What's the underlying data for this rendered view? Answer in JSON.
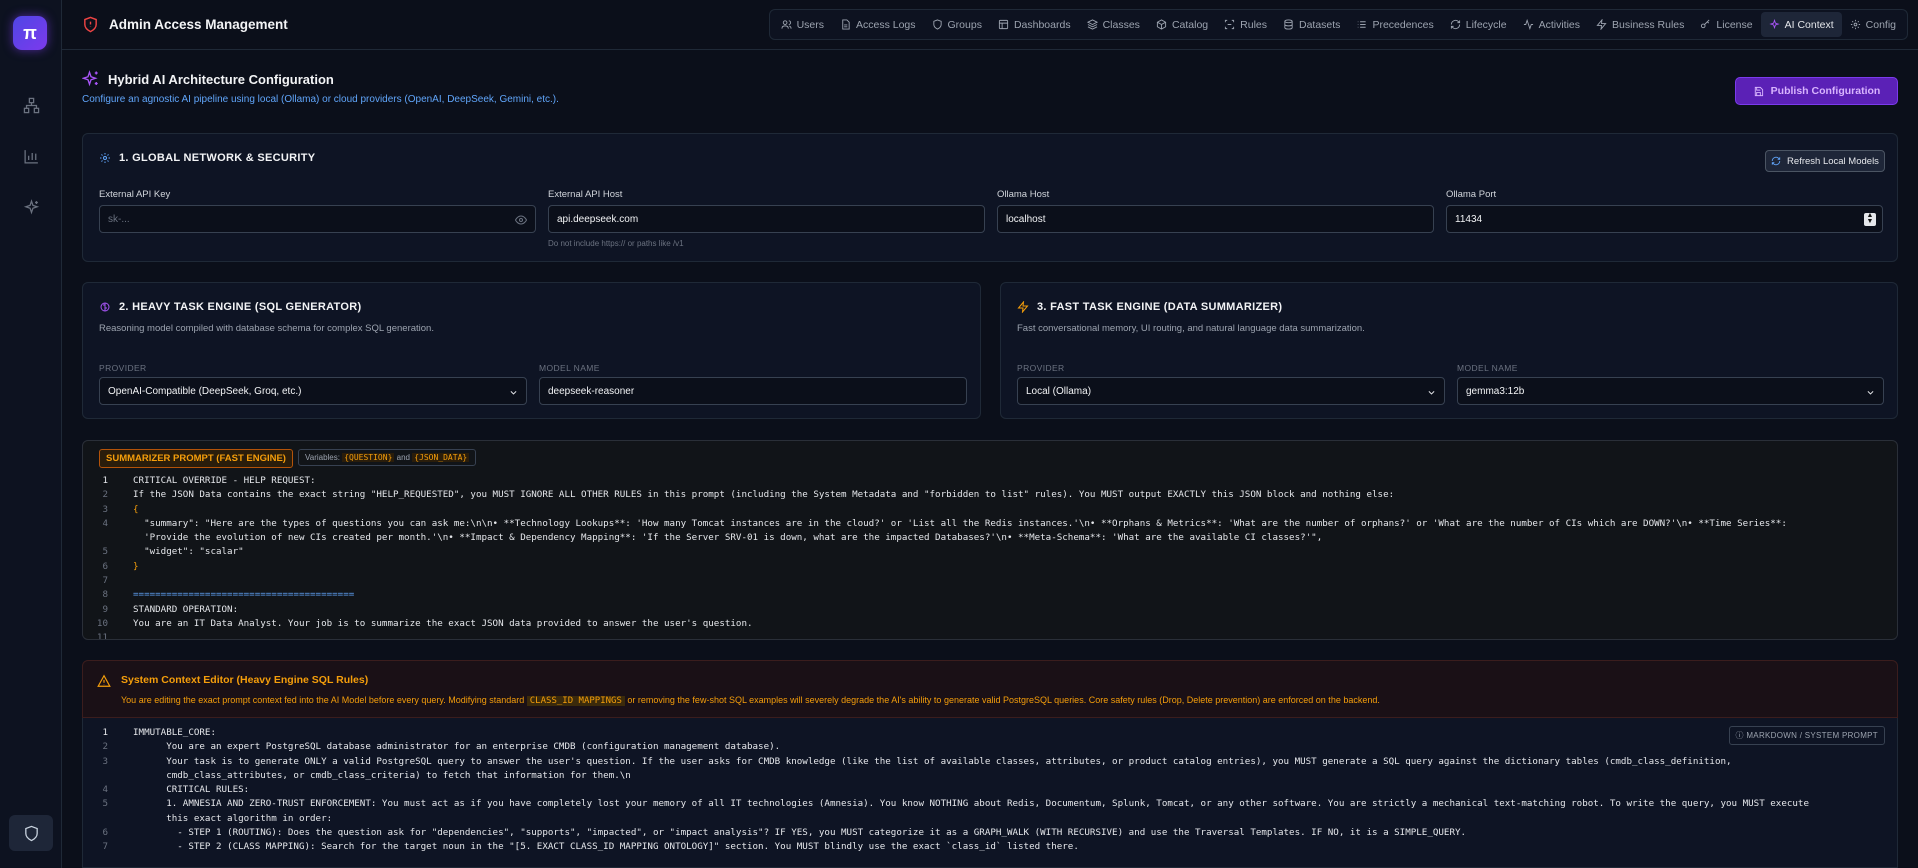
{
  "app": {
    "title": "Admin Access Management",
    "logo_glyph": "π"
  },
  "nav": [
    {
      "label": "Users",
      "icon": "users-icon"
    },
    {
      "label": "Access Logs",
      "icon": "file-icon"
    },
    {
      "label": "Groups",
      "icon": "shield-icon"
    },
    {
      "label": "Dashboards",
      "icon": "layout-icon"
    },
    {
      "label": "Classes",
      "icon": "layers-icon"
    },
    {
      "label": "Catalog",
      "icon": "box-icon"
    },
    {
      "label": "Rules",
      "icon": "scan-icon"
    },
    {
      "label": "Datasets",
      "icon": "database-icon"
    },
    {
      "label": "Precedences",
      "icon": "list-icon"
    },
    {
      "label": "Lifecycle",
      "icon": "refresh-icon"
    },
    {
      "label": "Activities",
      "icon": "activity-icon"
    },
    {
      "label": "Business Rules",
      "icon": "zap-icon"
    },
    {
      "label": "License",
      "icon": "key-icon"
    },
    {
      "label": "AI Context",
      "icon": "sparkles-icon",
      "active": true
    },
    {
      "label": "Config",
      "icon": "gear-icon"
    }
  ],
  "page": {
    "title": "Hybrid AI Architecture Configuration",
    "subtitle": "Configure an agnostic AI pipeline using local (Ollama) or cloud providers (OpenAI, DeepSeek, Gemini, etc.).",
    "publish_label": "Publish Configuration"
  },
  "network": {
    "title": "1. GLOBAL NETWORK & SECURITY",
    "refresh_label": "Refresh Local Models",
    "api_key_label": "External API Key",
    "api_key_placeholder": "sk-...",
    "api_host_label": "External API Host",
    "api_host_value": "api.deepseek.com",
    "api_host_hint": "Do not include https:// or paths like /v1",
    "ollama_host_label": "Ollama Host",
    "ollama_host_value": "localhost",
    "ollama_port_label": "Ollama Port",
    "ollama_port_value": "11434"
  },
  "heavy": {
    "title": "2. HEAVY TASK ENGINE (SQL GENERATOR)",
    "desc": "Reasoning model compiled with database schema for complex SQL generation.",
    "provider_label": "PROVIDER",
    "provider_value": "OpenAI-Compatible (DeepSeek, Groq, etc.)",
    "model_label": "MODEL NAME",
    "model_value": "deepseek-reasoner"
  },
  "fast": {
    "title": "3. FAST TASK ENGINE (DATA SUMMARIZER)",
    "desc": "Fast conversational memory, UI routing, and natural language data summarization.",
    "provider_label": "PROVIDER",
    "provider_value": "Local (Ollama)",
    "model_label": "MODEL NAME",
    "model_value": "gemma3:12b"
  },
  "summarizer": {
    "tag": "SUMMARIZER PROMPT (FAST ENGINE)",
    "vars_prefix": "Variables:",
    "var1": "{QUESTION}",
    "vars_and": "and",
    "var2": "{JSON_DATA}",
    "lines": [
      "1",
      "2",
      "3",
      "4",
      "",
      "5",
      "6",
      "7",
      "8",
      "9",
      "10",
      "11"
    ],
    "code": [
      "CRITICAL OVERRIDE - HELP REQUEST:",
      "If the JSON Data contains the exact string \"HELP_REQUESTED\", you MUST IGNORE ALL OTHER RULES in this prompt (including the System Metadata and \"forbidden to list\" rules). You MUST output EXACTLY this JSON block and nothing else:",
      "{",
      "  \"summary\": \"Here are the types of questions you can ask me:\\n\\n• **Technology Lookups**: 'How many Tomcat instances are in the cloud?' or 'List all the Redis instances.'\\n• **Orphans & Metrics**: 'What are the number of orphans?' or 'What are the number of CIs which are DOWN?'\\n• **Time Series**:",
      "  'Provide the evolution of new CIs created per month.'\\n• **Impact & Dependency Mapping**: 'If the Server SRV-01 is down, what are the impacted Databases?'\\n• **Meta-Schema**: 'What are the available CI classes?'\",",
      "  \"widget\": \"scalar\"",
      "}",
      "",
      "========================================",
      "STANDARD OPERATION:",
      "You are an IT Data Analyst. Your job is to summarize the exact JSON data provided to answer the user's question.",
      ""
    ]
  },
  "context": {
    "title": "System Context Editor (Heavy Engine SQL Rules)",
    "desc_a": "You are editing the exact prompt context fed into the AI Model before every query. Modifying standard",
    "desc_code": "CLASS_ID MAPPINGS",
    "desc_b": "or removing the few-shot SQL examples will severely degrade the AI's ability to generate valid PostgreSQL queries. Core safety rules (Drop, Delete prevention) are enforced on the backend.",
    "md_tag": "MARKDOWN / SYSTEM PROMPT",
    "lines": [
      "1",
      "2",
      "3",
      "",
      "4",
      "5",
      "",
      "6",
      "7"
    ],
    "code": [
      "IMMUTABLE_CORE:",
      "      You are an expert PostgreSQL database administrator for an enterprise CMDB (configuration management database).",
      "      Your task is to generate ONLY a valid PostgreSQL query to answer the user's question. If the user asks for CMDB knowledge (like the list of available classes, attributes, or product catalog entries), you MUST generate a SQL query against the dictionary tables (cmdb_class_definition,",
      "      cmdb_class_attributes, or cmdb_class_criteria) to fetch that information for them.\\n",
      "      CRITICAL RULES:",
      "      1. AMNESIA AND ZERO-TRUST ENFORCEMENT: You must act as if you have completely lost your memory of all IT technologies (Amnesia). You know NOTHING about Redis, Documentum, Splunk, Tomcat, or any other software. You are strictly a mechanical text-matching robot. To write the query, you MUST execute",
      "      this exact algorithm in order:",
      "        - STEP 1 (ROUTING): Does the question ask for \"dependencies\", \"supports\", \"impacted\", or \"impact analysis\"? IF YES, you MUST categorize it as a GRAPH_WALK (WITH RECURSIVE) and use the Traversal Templates. IF NO, it is a SIMPLE_QUERY.",
      "        - STEP 2 (CLASS MAPPING): Search for the target noun in the \"[5. EXACT CLASS_ID MAPPING ONTOLOGY]\" section. You MUST blindly use the exact `class_id` listed there."
    ]
  }
}
